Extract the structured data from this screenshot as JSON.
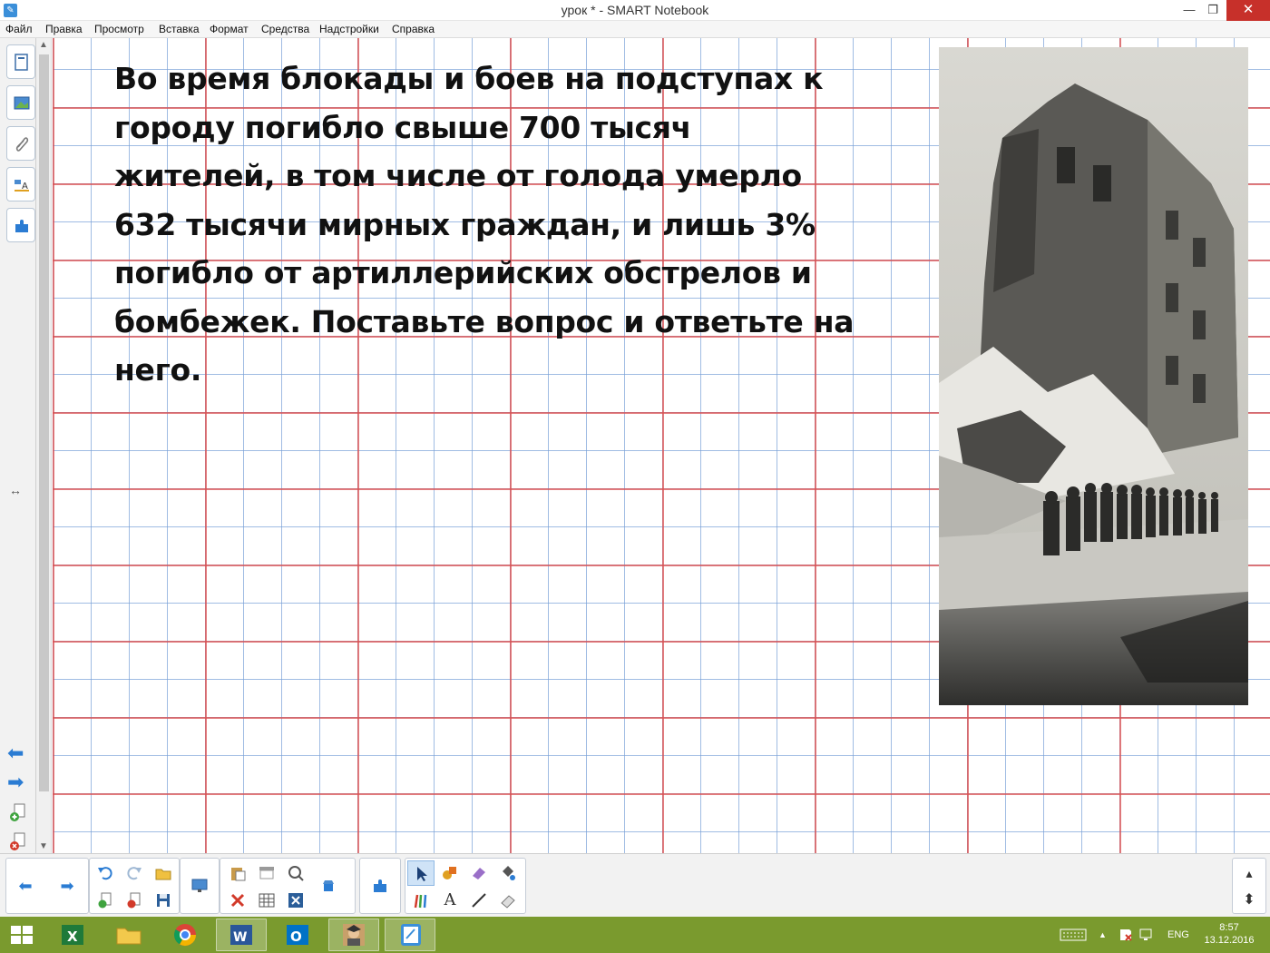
{
  "window": {
    "title": "урок * - SMART Notebook",
    "minimize": "—",
    "maximize": "❐",
    "close": "✕",
    "app_icon": "smart-notebook-icon"
  },
  "menu": [
    "Файл",
    "Правка",
    "Просмотр",
    "Вставка",
    "Формат",
    "Средства",
    "Надстройки",
    "Справка"
  ],
  "sidebar": {
    "tabs": [
      "page-sorter-icon",
      "gallery-icon",
      "attachments-icon",
      "properties-icon",
      "addons-icon"
    ],
    "resize_glyph": "↔",
    "prev_arrow": "⬅",
    "next_arrow": "➡"
  },
  "slide": {
    "text": "Во время блокады и боев на подступах к городу погибло свыше 700 тысяч жителей, в том числе от голода умерло 632 тысячи мирных граждан, и лишь 3% погибло от артиллерийских обстрелов и бомбежек. Поставьте вопрос и ответьте на него.",
    "grid_colors": {
      "major": "#dc5050",
      "minor": "#78a0d7"
    }
  },
  "toolbar": {
    "prev": "⬅",
    "next": "➡",
    "icons": [
      "undo-icon",
      "redo-icon",
      "open-folder-icon",
      "add-page-icon",
      "delete-page-icon",
      "save-icon",
      "display-icon",
      "paste-icon",
      "delete-icon",
      "screen-shade-icon",
      "table-icon",
      "capture-icon",
      "clear-page-icon",
      "properties-icon",
      "addons-icon",
      "select-icon",
      "shapes-icon",
      "eraser-icon",
      "fill-icon",
      "pens-icon",
      "text-icon",
      "line-icon",
      "magic-eraser-icon"
    ],
    "text_tool": "A",
    "toggle_up": "▴",
    "toggle_updown": "⬍"
  },
  "taskbar": {
    "apps": [
      "start-icon",
      "excel-icon",
      "explorer-icon",
      "chrome-icon",
      "word-icon",
      "outlook-icon",
      "teacher-icon",
      "smart-notebook-icon"
    ],
    "language": "ENG",
    "time": "8:57",
    "date": "13.12.2016",
    "tray_arrow": "▲"
  },
  "colors": {
    "taskbar": "#7a9a2e",
    "close_button": "#c7302a",
    "accent": "#2b7cd3"
  }
}
